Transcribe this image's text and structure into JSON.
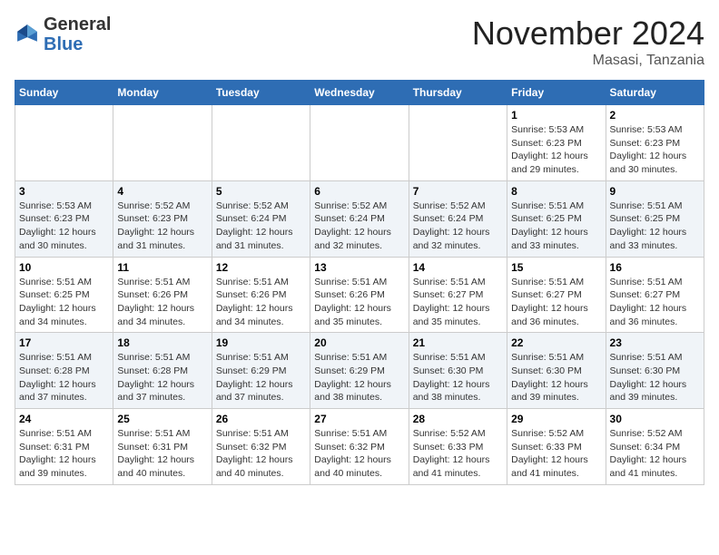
{
  "header": {
    "logo_general": "General",
    "logo_blue": "Blue",
    "month": "November 2024",
    "location": "Masasi, Tanzania"
  },
  "weekdays": [
    "Sunday",
    "Monday",
    "Tuesday",
    "Wednesday",
    "Thursday",
    "Friday",
    "Saturday"
  ],
  "weeks": [
    [
      {
        "day": "",
        "info": ""
      },
      {
        "day": "",
        "info": ""
      },
      {
        "day": "",
        "info": ""
      },
      {
        "day": "",
        "info": ""
      },
      {
        "day": "",
        "info": ""
      },
      {
        "day": "1",
        "info": "Sunrise: 5:53 AM\nSunset: 6:23 PM\nDaylight: 12 hours\nand 29 minutes."
      },
      {
        "day": "2",
        "info": "Sunrise: 5:53 AM\nSunset: 6:23 PM\nDaylight: 12 hours\nand 30 minutes."
      }
    ],
    [
      {
        "day": "3",
        "info": "Sunrise: 5:53 AM\nSunset: 6:23 PM\nDaylight: 12 hours\nand 30 minutes."
      },
      {
        "day": "4",
        "info": "Sunrise: 5:52 AM\nSunset: 6:23 PM\nDaylight: 12 hours\nand 31 minutes."
      },
      {
        "day": "5",
        "info": "Sunrise: 5:52 AM\nSunset: 6:24 PM\nDaylight: 12 hours\nand 31 minutes."
      },
      {
        "day": "6",
        "info": "Sunrise: 5:52 AM\nSunset: 6:24 PM\nDaylight: 12 hours\nand 32 minutes."
      },
      {
        "day": "7",
        "info": "Sunrise: 5:52 AM\nSunset: 6:24 PM\nDaylight: 12 hours\nand 32 minutes."
      },
      {
        "day": "8",
        "info": "Sunrise: 5:51 AM\nSunset: 6:25 PM\nDaylight: 12 hours\nand 33 minutes."
      },
      {
        "day": "9",
        "info": "Sunrise: 5:51 AM\nSunset: 6:25 PM\nDaylight: 12 hours\nand 33 minutes."
      }
    ],
    [
      {
        "day": "10",
        "info": "Sunrise: 5:51 AM\nSunset: 6:25 PM\nDaylight: 12 hours\nand 34 minutes."
      },
      {
        "day": "11",
        "info": "Sunrise: 5:51 AM\nSunset: 6:26 PM\nDaylight: 12 hours\nand 34 minutes."
      },
      {
        "day": "12",
        "info": "Sunrise: 5:51 AM\nSunset: 6:26 PM\nDaylight: 12 hours\nand 34 minutes."
      },
      {
        "day": "13",
        "info": "Sunrise: 5:51 AM\nSunset: 6:26 PM\nDaylight: 12 hours\nand 35 minutes."
      },
      {
        "day": "14",
        "info": "Sunrise: 5:51 AM\nSunset: 6:27 PM\nDaylight: 12 hours\nand 35 minutes."
      },
      {
        "day": "15",
        "info": "Sunrise: 5:51 AM\nSunset: 6:27 PM\nDaylight: 12 hours\nand 36 minutes."
      },
      {
        "day": "16",
        "info": "Sunrise: 5:51 AM\nSunset: 6:27 PM\nDaylight: 12 hours\nand 36 minutes."
      }
    ],
    [
      {
        "day": "17",
        "info": "Sunrise: 5:51 AM\nSunset: 6:28 PM\nDaylight: 12 hours\nand 37 minutes."
      },
      {
        "day": "18",
        "info": "Sunrise: 5:51 AM\nSunset: 6:28 PM\nDaylight: 12 hours\nand 37 minutes."
      },
      {
        "day": "19",
        "info": "Sunrise: 5:51 AM\nSunset: 6:29 PM\nDaylight: 12 hours\nand 37 minutes."
      },
      {
        "day": "20",
        "info": "Sunrise: 5:51 AM\nSunset: 6:29 PM\nDaylight: 12 hours\nand 38 minutes."
      },
      {
        "day": "21",
        "info": "Sunrise: 5:51 AM\nSunset: 6:30 PM\nDaylight: 12 hours\nand 38 minutes."
      },
      {
        "day": "22",
        "info": "Sunrise: 5:51 AM\nSunset: 6:30 PM\nDaylight: 12 hours\nand 39 minutes."
      },
      {
        "day": "23",
        "info": "Sunrise: 5:51 AM\nSunset: 6:30 PM\nDaylight: 12 hours\nand 39 minutes."
      }
    ],
    [
      {
        "day": "24",
        "info": "Sunrise: 5:51 AM\nSunset: 6:31 PM\nDaylight: 12 hours\nand 39 minutes."
      },
      {
        "day": "25",
        "info": "Sunrise: 5:51 AM\nSunset: 6:31 PM\nDaylight: 12 hours\nand 40 minutes."
      },
      {
        "day": "26",
        "info": "Sunrise: 5:51 AM\nSunset: 6:32 PM\nDaylight: 12 hours\nand 40 minutes."
      },
      {
        "day": "27",
        "info": "Sunrise: 5:51 AM\nSunset: 6:32 PM\nDaylight: 12 hours\nand 40 minutes."
      },
      {
        "day": "28",
        "info": "Sunrise: 5:52 AM\nSunset: 6:33 PM\nDaylight: 12 hours\nand 41 minutes."
      },
      {
        "day": "29",
        "info": "Sunrise: 5:52 AM\nSunset: 6:33 PM\nDaylight: 12 hours\nand 41 minutes."
      },
      {
        "day": "30",
        "info": "Sunrise: 5:52 AM\nSunset: 6:34 PM\nDaylight: 12 hours\nand 41 minutes."
      }
    ]
  ]
}
